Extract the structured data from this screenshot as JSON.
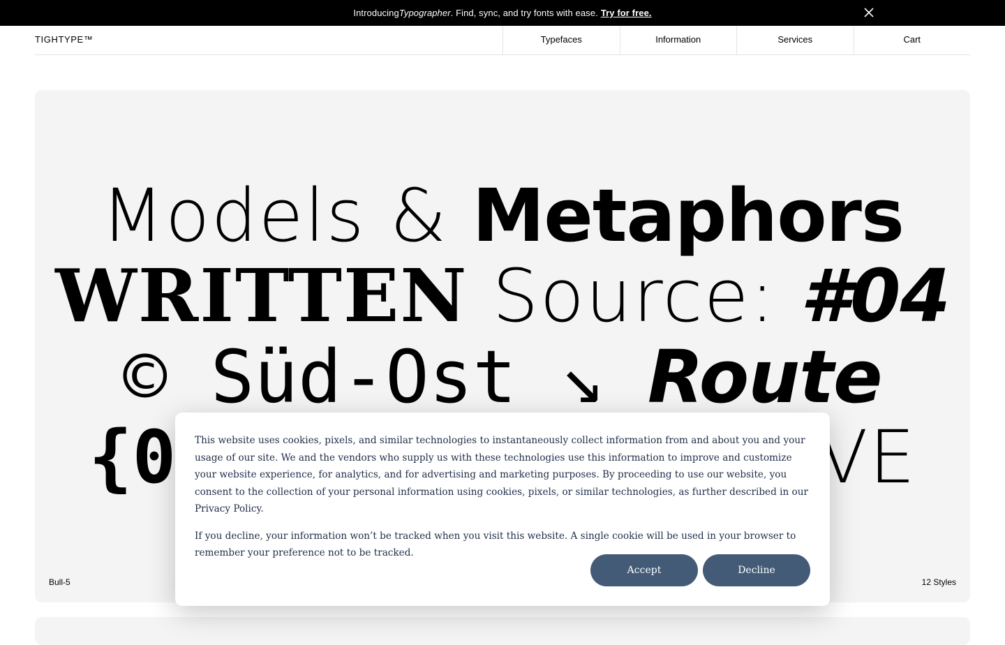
{
  "announcement": {
    "prefix": "Introducing ",
    "product": "Typographer",
    "suffix": ". Find, sync, and try fonts with ease.",
    "cta": "Try for free.",
    "close_icon": "close-icon"
  },
  "header": {
    "logo": "TIGHTYPE™",
    "nav": [
      "Typefaces",
      "Information",
      "Services",
      "Cart"
    ]
  },
  "hero": {
    "line1": {
      "a": "Models & ",
      "b": "Metaphors"
    },
    "line2": {
      "a": "WRITTEN",
      "b": " Source: ",
      "c": "#04"
    },
    "line3": {
      "a": "© Süd-Ost ↘ ",
      "b": "Route"
    },
    "line4": {
      "a": "{0",
      "b": "VE"
    },
    "font_name": "Bull-5",
    "styles_count": "12 Styles"
  },
  "cookie": {
    "paragraph1_before_link": "This website uses cookies, pixels, and similar technologies to instantaneously collect information from and about you and your usage of our site. We and the vendors who supply us with these technologies use this information to improve and customize your website experience, for analytics, and for advertising and marketing purposes. By proceeding to use our website, you consent to the collection of your personal information using cookies, pixels, or similar technologies, as further described in our ",
    "privacy_link": "Privacy Policy",
    "paragraph1_after_link": ".",
    "paragraph2": "If you decline, your information won’t be tracked when you visit this website. A single cookie will be used in your browser to remember your preference not to be tracked.",
    "accept_label": "Accept",
    "decline_label": "Decline"
  },
  "colors": {
    "announcement_bg": "#000000",
    "hero_bg": "#f4f4f5",
    "cookie_text": "#1f2d47",
    "button_bg": "#445b77"
  }
}
